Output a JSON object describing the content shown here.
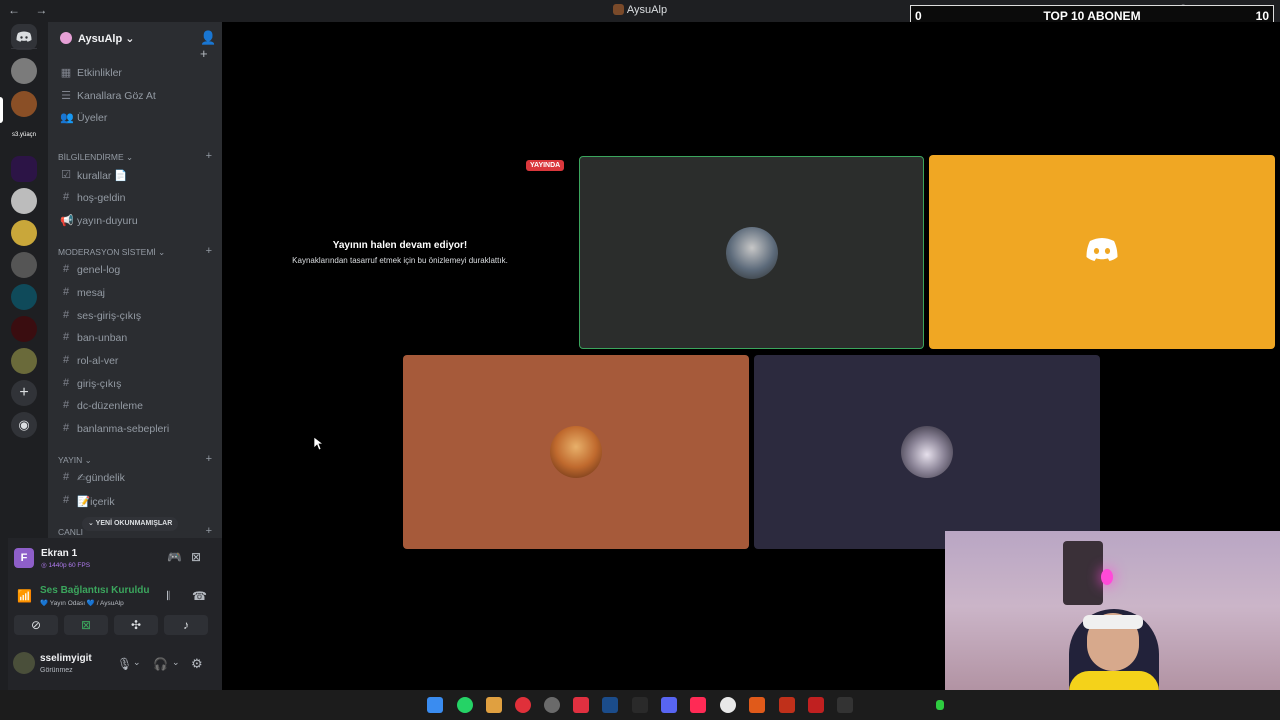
{
  "titlebar": {
    "app_title": "AysuAlp",
    "nav_arrows": "← →"
  },
  "overlay": {
    "left_value": "0",
    "title": "TOP 10 ABONEM",
    "right_value": "10"
  },
  "server_rail": {
    "label_text": "s3.yüaçn"
  },
  "server": {
    "name": "AysuAlp",
    "chevron": "⌄",
    "top_items": [
      {
        "label": "Etkinlikler",
        "icon": "calendar-icon",
        "glyph": "▦"
      },
      {
        "label": "Kanallara Göz At",
        "icon": "browse-channels-icon",
        "glyph": "☰"
      },
      {
        "label": "Üyeler",
        "icon": "members-icon",
        "glyph": "👥"
      }
    ],
    "categories": [
      {
        "name": "BİLGİLENDİRME ⌄",
        "channels": [
          {
            "label": "kurallar 📄",
            "glyph": "☑"
          },
          {
            "label": "hoş-geldin",
            "glyph": "#"
          },
          {
            "label": "yayın-duyuru",
            "glyph": "📢"
          }
        ]
      },
      {
        "name": "MODERASYON SİSTEMİ ⌄",
        "channels": [
          {
            "label": "genel-log",
            "glyph": "#"
          },
          {
            "label": "mesaj",
            "glyph": "#"
          },
          {
            "label": "ses-giriş-çıkış",
            "glyph": "#"
          },
          {
            "label": "ban-unban",
            "glyph": "#"
          },
          {
            "label": "rol-al-ver",
            "glyph": "#"
          },
          {
            "label": "giriş-çıkış",
            "glyph": "#"
          },
          {
            "label": "dc-düzenleme",
            "glyph": "#"
          },
          {
            "label": "banlanma-sebepleri",
            "glyph": "#"
          }
        ]
      },
      {
        "name": "YAYIN ⌄",
        "channels": [
          {
            "label": "✍gündelik",
            "glyph": "#"
          },
          {
            "label": "📝içerik",
            "glyph": "#"
          }
        ]
      },
      {
        "name": "CANLI",
        "channels": []
      }
    ],
    "unread_pill": "⌄ YENİ OKUNMAMIŞLAR"
  },
  "screen_share": {
    "avatar_letter": "F",
    "title": "Ekran 1",
    "quality": "◎ 1440p 60 FPS"
  },
  "voice": {
    "status": "Ses Bağlantısı Kuruldu",
    "location": "💙 Yayın Odası 💙 / AysuAlp"
  },
  "controls": [
    {
      "name": "camera-off-button",
      "glyph": "⊘"
    },
    {
      "name": "stop-stream-button",
      "glyph": "⊠"
    },
    {
      "name": "activities-button",
      "glyph": "✣"
    },
    {
      "name": "soundboard-button",
      "glyph": "♪"
    }
  ],
  "user": {
    "name": "sselimyigit",
    "status": "Görünmez"
  },
  "stage": {
    "live_badge": "YAYINDA",
    "paused_title": "Yayının halen devam ediyor!",
    "paused_subtitle": "Kaynaklarından tasarruf etmek için bu önizlemeyi duraklattık."
  },
  "colors": {
    "discord_tile": "#f0a723",
    "speaking_border": "#3ba55d",
    "tile_dark": "#2b2d2c",
    "tile_brown": "#a65a3a",
    "tile_purple": "#2c2a3e",
    "voice_green": "#3ba55d",
    "live_red": "#da373c"
  }
}
